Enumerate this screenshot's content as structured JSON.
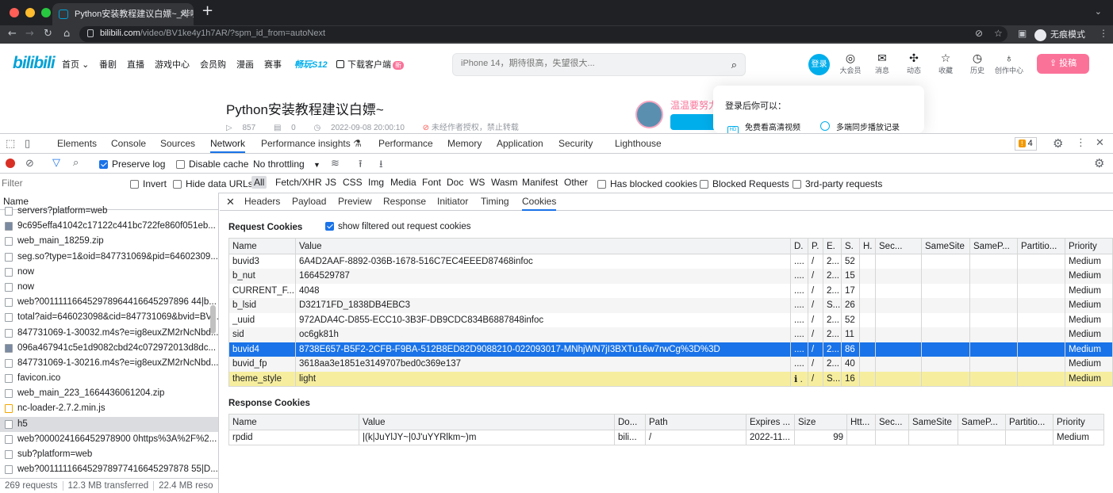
{
  "browser": {
    "tab_title": "Python安装教程建议白嫖~_哔哩",
    "url_domain": "bilibili.com",
    "url_path": "/video/BV1ke4y1h7AR/?spm_id_from=autoNext",
    "profile_label": "无痕模式"
  },
  "bili": {
    "logo": "bilibili",
    "nav": [
      "首页",
      "番剧",
      "直播",
      "游戏中心",
      "会员购",
      "漫画",
      "赛事"
    ],
    "event": "畅玩S12",
    "download": "下载客户端",
    "download_badge": "新",
    "search_placeholder": "iPhone 14，期待很高，失望很大...",
    "login": "登录",
    "icons": [
      {
        "label": "大会员",
        "icon": "vip-icon"
      },
      {
        "label": "消息",
        "icon": "message-icon"
      },
      {
        "label": "动态",
        "icon": "dynamic-icon"
      },
      {
        "label": "收藏",
        "icon": "favorite-icon"
      },
      {
        "label": "历史",
        "icon": "history-icon"
      },
      {
        "label": "创作中心",
        "icon": "creator-icon"
      }
    ],
    "upload": "投稿",
    "video_title": "Python安装教程建议白嫖~",
    "views": "857",
    "danmaku": "0",
    "date": "2022-09-08 20:00:10",
    "copyright": "未经作者授权，禁止转载",
    "uploader": "温温要努力",
    "popup_title": "登录后你可以：",
    "popup_items": [
      "免费看高清视频",
      "多端同步播放记录"
    ]
  },
  "devtools": {
    "tabs": [
      "Elements",
      "Console",
      "Sources",
      "Network",
      "Performance insights",
      "Performance",
      "Memory",
      "Application",
      "Security",
      "Lighthouse"
    ],
    "active_tab": "Network",
    "issues_count": "4",
    "preserve_log": "Preserve log",
    "disable_cache": "Disable cache",
    "throttling": "No throttling",
    "filter_placeholder": "Filter",
    "invert": "Invert",
    "hide_data_urls": "Hide data URLs",
    "type_filters": [
      "All",
      "Fetch/XHR",
      "JS",
      "CSS",
      "Img",
      "Media",
      "Font",
      "Doc",
      "WS",
      "Wasm",
      "Manifest",
      "Other"
    ],
    "has_blocked_cookies": "Has blocked cookies",
    "blocked_requests": "Blocked Requests",
    "third_party": "3rd-party requests",
    "name_header": "Name",
    "requests": [
      "servers?platform=web",
      "9c695effa41042c17122c441bc722fe860f051eb...",
      "web_main_18259.zip",
      "seg.so?type=1&oid=847731069&pid=64602309...",
      "now",
      "now",
      "web?001111166452978964416645297896 44|b...",
      "total?aid=646023098&cid=847731069&bvid=BV...",
      "847731069-1-30032.m4s?e=ig8euxZM2rNcNbd...",
      "096a467941c5e1d9082cbd24c072972013d8dc...",
      "847731069-1-30216.m4s?e=ig8euxZM2rNcNbd...",
      "favicon.ico",
      "web_main_223_1664436061204.zip",
      "nc-loader-2.7.2.min.js",
      "h5",
      "web?000024166452978900 0https%3A%2F%2...",
      "sub?platform=web",
      "web?001111166452978977416645297878 55|D..."
    ],
    "selected_request": "h5",
    "footer": [
      "269 requests",
      "12.3 MB transferred",
      "22.4 MB reso"
    ],
    "detail_tabs": [
      "Headers",
      "Payload",
      "Preview",
      "Response",
      "Initiator",
      "Timing",
      "Cookies"
    ],
    "active_detail_tab": "Cookies",
    "request_cookies_title": "Request Cookies",
    "show_filtered": "show filtered out request cookies",
    "req_cookie_columns": [
      "Name",
      "Value",
      "D.",
      "P.",
      "E.",
      "S.",
      "H.",
      "Sec...",
      "SameSite",
      "SameP...",
      "Partitio...",
      "Priority"
    ],
    "req_cookies": [
      [
        "buvid3",
        "6A4D2AAF-8892-036B-1678-516C7EC4EEED87468infoc",
        "....",
        "/",
        "2...",
        "52",
        "",
        "",
        "",
        "",
        "",
        "Medium"
      ],
      [
        "b_nut",
        "1664529787",
        "....",
        "/",
        "2...",
        "15",
        "",
        "",
        "",
        "",
        "",
        "Medium"
      ],
      [
        "CURRENT_F...",
        "4048",
        "....",
        "/",
        "2...",
        "17",
        "",
        "",
        "",
        "",
        "",
        "Medium"
      ],
      [
        "b_lsid",
        "D32171FD_1838DB4EBC3",
        "....",
        "/",
        "S...",
        "26",
        "",
        "",
        "",
        "",
        "",
        "Medium"
      ],
      [
        "_uuid",
        "972ADA4C-D855-ECC10-3B3F-DB9CDC834B6887848infoc",
        "....",
        "/",
        "2...",
        "52",
        "",
        "",
        "",
        "",
        "",
        "Medium"
      ],
      [
        "sid",
        "oc6gk81h",
        "....",
        "/",
        "2...",
        "11",
        "",
        "",
        "",
        "",
        "",
        "Medium"
      ],
      [
        "buvid4",
        "8738E657-B5F2-2CFB-F9BA-512B8ED82D9088210-022093017-MNhjWN7jI3BXTu16w7rwCg%3D%3D",
        "....",
        "/",
        "2...",
        "86",
        "",
        "",
        "",
        "",
        "",
        "Medium"
      ],
      [
        "buvid_fp",
        "3618aa3e1851e3149707bed0c369e137",
        "....",
        "/",
        "2...",
        "40",
        "",
        "",
        "",
        "",
        "",
        "Medium"
      ],
      [
        "theme_style",
        "light",
        ".",
        "/",
        "S...",
        "16",
        "",
        "",
        "",
        "",
        "",
        "Medium"
      ]
    ],
    "selected_cookie": "buvid4",
    "warning_cookie": "theme_style",
    "response_cookies_title": "Response Cookies",
    "resp_cookie_columns": [
      "Name",
      "Value",
      "Do...",
      "Path",
      "Expires ...",
      "Size",
      "Htt...",
      "Sec...",
      "SameSite",
      "SameP...",
      "Partitio...",
      "Priority"
    ],
    "resp_cookies": [
      [
        "rpdid",
        "|(k|JuYlJY~|0J'uYYRlkm~)m",
        "bili...",
        "/",
        "2022-11...",
        "99",
        "",
        "",
        "",
        "",
        "",
        "Medium"
      ]
    ]
  },
  "colors": {
    "accent": "#1a73e8",
    "bili_blue": "#00aeec",
    "bili_pink": "#fb7299"
  }
}
